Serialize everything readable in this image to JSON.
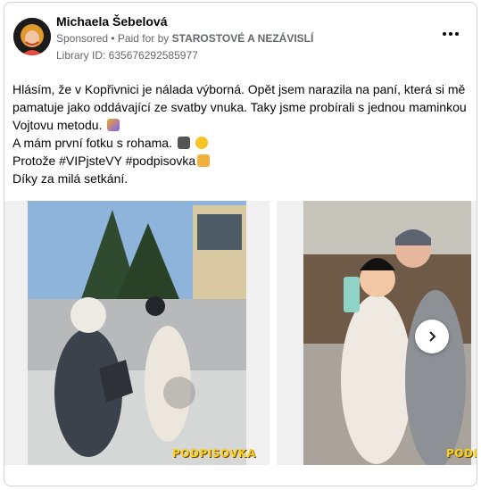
{
  "post": {
    "author": "Michaela Šebelová",
    "sponsored": "Sponsored",
    "paid_for_prefix": "• Paid for by",
    "paid_for_by": "STAROSTOVÉ A NEZÁVISLÍ",
    "library_id": "Library ID: 635676292585977",
    "text_lines": [
      "Hlásím, že v Kopřivnici je nálada výborná. Opět jsem narazila na paní, která si mě",
      "pamatuje jako oddávající ze svatby vnuka. Taky jsme probírali s jednou maminkou",
      "Vojtovu metodu.",
      "A mám první fotku s rohama.",
      "Protože #VIPjsteVY #podpisovka",
      "Díky za milá setkání."
    ]
  },
  "carousel": {
    "slides": [
      {
        "name": "slide-1",
        "overlay_text": "PODPISOVKA"
      },
      {
        "name": "slide-2",
        "overlay_text": "PODPI"
      }
    ],
    "next_icon": "chevron-right-icon"
  },
  "icons": {
    "more": "ellipsis-icon",
    "emoji_line3": "family-emoji-icon",
    "emoji_line4a": "camera-emoji-icon",
    "emoji_line4b": "smile-emoji-icon",
    "emoji_line5": "writing-hand-emoji-icon"
  },
  "colors": {
    "meta_gray": "#65676b",
    "text": "#050505",
    "border": "#d0d3d8",
    "sticker_yellow": "#f7d31c"
  }
}
